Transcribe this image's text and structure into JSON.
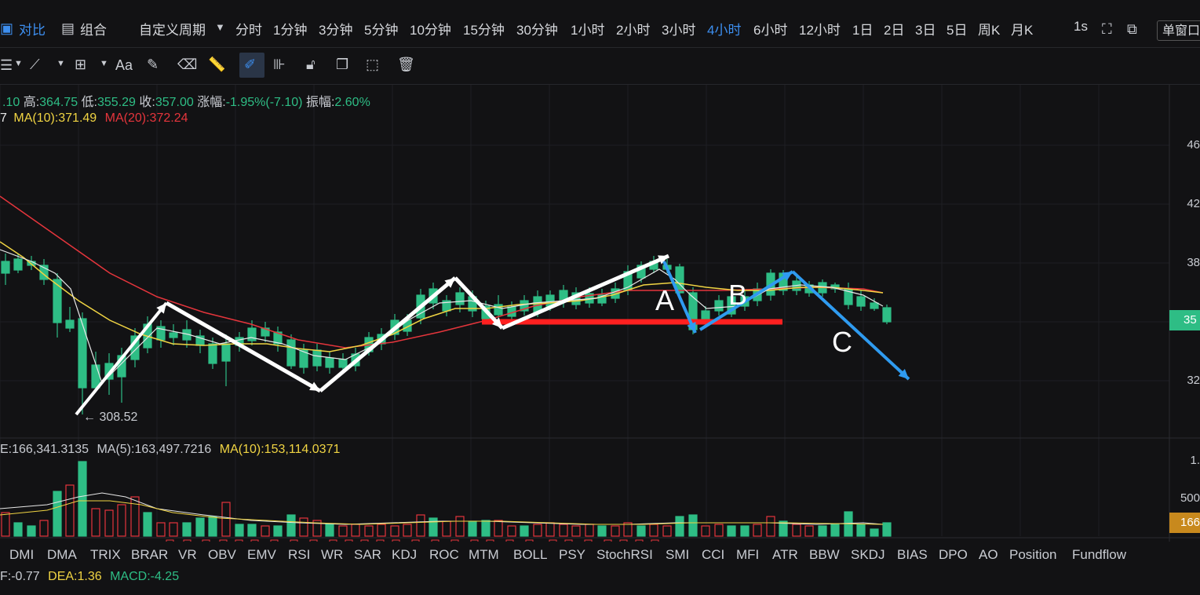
{
  "topbar": {
    "compare": "对比",
    "combine": "组合",
    "custom_period": "自定义周期",
    "periods": [
      "分时",
      "1分钟",
      "3分钟",
      "5分钟",
      "10分钟",
      "15分钟",
      "30分钟",
      "1小时",
      "2小时",
      "3小时",
      "4小时",
      "6小时",
      "12小时",
      "1日",
      "2日",
      "3日",
      "5日",
      "周K",
      "月K"
    ],
    "active_period": "4小时",
    "refresh": "1s",
    "window_mode": "单窗口"
  },
  "toolbar": {
    "icons": [
      "menu-icon",
      "line-tool-icon",
      "crosshair-icon",
      "text-icon",
      "brush-icon",
      "eraser-icon",
      "ruler-icon",
      "draw-icon",
      "pattern-icon",
      "lock-icon",
      "copy-icon",
      "screenshot-icon",
      "trash-icon"
    ],
    "text_tool": "Aa"
  },
  "price_legend": {
    "open_partial": ".10",
    "high_label": "高:",
    "high": "364.75",
    "low_label": "低:",
    "low": "355.29",
    "close_label": "收:",
    "close": "357.00",
    "change_label": "涨幅:",
    "change": "-1.95%(-7.10)",
    "amplitude_label": "振幅:",
    "amplitude": "2.60%"
  },
  "ma_legend": {
    "ma5_partial": "7",
    "ma10": "MA(10):371.49",
    "ma20": "MA(20):372.24"
  },
  "annotations": {
    "low_marker": "← 308.52",
    "label_a": "A",
    "label_b": "B",
    "label_c": "C"
  },
  "price_axis": [
    "46",
    "42",
    "38",
    "35",
    "32"
  ],
  "current_price_tag": "35",
  "volume_legend": {
    "vol": "E:166,341.3135",
    "ma5": "MA(5):163,497.7216",
    "ma10": "MA(10):153,114.0371"
  },
  "volume_axis": [
    "1.",
    "500",
    "166"
  ],
  "indicators": [
    "DMI",
    "DMA",
    "TRIX",
    "BRAR",
    "VR",
    "OBV",
    "EMV",
    "RSI",
    "WR",
    "SAR",
    "KDJ",
    "ROC",
    "MTM",
    "BOLL",
    "PSY",
    "StochRSI",
    "SMI",
    "CCI",
    "MFI",
    "ATR",
    "BBW",
    "SKDJ",
    "BIAS",
    "DPO",
    "AO",
    "Position",
    "Fundflow"
  ],
  "macd_legend": {
    "dif": "F:-0.77",
    "dea": "DEA:1.36",
    "macd": "MACD:-4.25"
  },
  "colors": {
    "up": "#e5353c",
    "down": "#2ebd85",
    "ma5": "#e8e8e8",
    "ma10": "#f0d443",
    "ma20": "#e5353c",
    "arrow_white": "#ffffff",
    "arrow_blue": "#2f9bf0",
    "support_line": "#ff2020",
    "active": "#3d8ff0"
  }
}
